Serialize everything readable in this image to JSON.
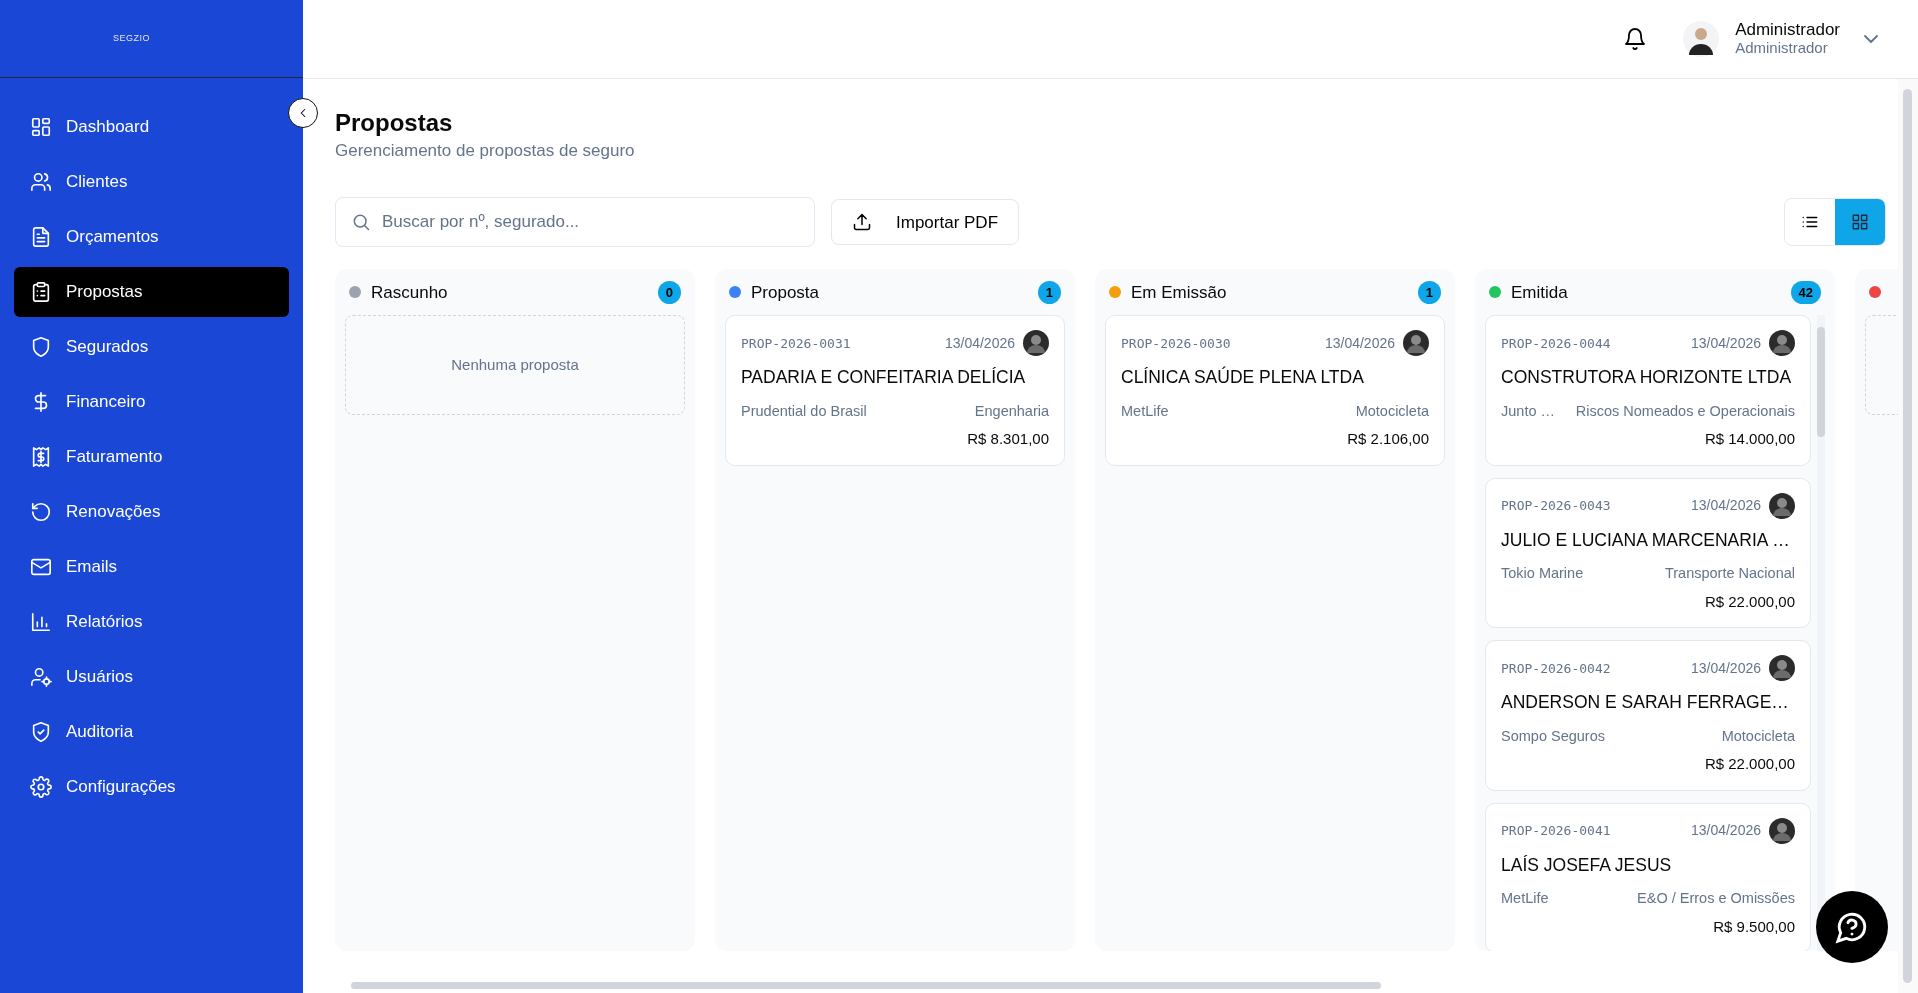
{
  "brand": "SEGZIO",
  "sidebar": {
    "items": [
      {
        "label": "Dashboard",
        "selected": false
      },
      {
        "label": "Clientes",
        "selected": false
      },
      {
        "label": "Orçamentos",
        "selected": false
      },
      {
        "label": "Propostas",
        "selected": true
      },
      {
        "label": "Segurados",
        "selected": false
      },
      {
        "label": "Financeiro",
        "selected": false
      },
      {
        "label": "Faturamento",
        "selected": false
      },
      {
        "label": "Renovações",
        "selected": false
      },
      {
        "label": "Emails",
        "selected": false
      },
      {
        "label": "Relatórios",
        "selected": false
      },
      {
        "label": "Usuários",
        "selected": false
      },
      {
        "label": "Auditoria",
        "selected": false
      },
      {
        "label": "Configurações",
        "selected": false
      }
    ]
  },
  "user": {
    "name": "Administrador",
    "role": "Administrador"
  },
  "page": {
    "title": "Propostas",
    "subtitle": "Gerenciamento de propostas de seguro"
  },
  "search": {
    "placeholder": "Buscar por nº, segurado..."
  },
  "import_button": "Importar PDF",
  "view_toggle": [
    {
      "kind": "list",
      "selected": false
    },
    {
      "kind": "grid",
      "selected": true
    }
  ],
  "columns": [
    {
      "title": "Rascunho",
      "color": "#9ca3af",
      "count": "0",
      "empty_text": "Nenhuma proposta"
    },
    {
      "title": "Proposta",
      "color": "#3b82f6",
      "count": "1",
      "cards": [
        {
          "number": "PROP-2026-0031",
          "date": "13/04/2026",
          "name": "PADARIA E CONFEITARIA DELÍCIA",
          "insurer": "Prudential do Brasil",
          "line": "Engenharia",
          "amount": "R$ 8.301,00"
        }
      ]
    },
    {
      "title": "Em Emissão",
      "color": "#f59e0b",
      "count": "1",
      "cards": [
        {
          "number": "PROP-2026-0030",
          "date": "13/04/2026",
          "name": "CLÍNICA SAÚDE PLENA LTDA",
          "insurer": "MetLife",
          "line": "Motocicleta",
          "amount": "R$ 2.106,00"
        }
      ]
    },
    {
      "title": "Emitida",
      "color": "#22c55e",
      "count": "42",
      "cards": [
        {
          "number": "PROP-2026-0044",
          "date": "13/04/2026",
          "name": "CONSTRUTORA HORIZONTE LTDA",
          "insurer": "Junto …",
          "line": "Riscos Nomeados e Operacionais",
          "amount": "R$ 14.000,00"
        },
        {
          "number": "PROP-2026-0043",
          "date": "13/04/2026",
          "name": "JULIO E LUCIANA MARCENARIA …",
          "insurer": "Tokio Marine",
          "line": "Transporte Nacional",
          "amount": "R$ 22.000,00"
        },
        {
          "number": "PROP-2026-0042",
          "date": "13/04/2026",
          "name": "ANDERSON E SARAH FERRAGE…",
          "insurer": "Sompo Seguros",
          "line": "Motocicleta",
          "amount": "R$ 22.000,00"
        },
        {
          "number": "PROP-2026-0041",
          "date": "13/04/2026",
          "name": "LAÍS JOSEFA JESUS",
          "insurer": "MetLife",
          "line": "E&O / Erros e Omissões",
          "amount": "R$ 9.500,00"
        }
      ]
    },
    {
      "color": "#ef4444"
    }
  ]
}
